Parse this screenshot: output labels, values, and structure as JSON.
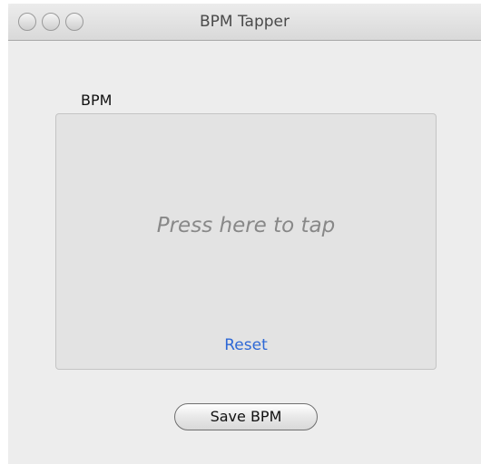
{
  "window": {
    "title": "BPM Tapper"
  },
  "bpm": {
    "label": "BPM"
  },
  "tap_area": {
    "hint": "Press here to tap",
    "reset_label": "Reset"
  },
  "footer": {
    "save_label": "Save BPM"
  },
  "colors": {
    "link": "#2e68d6",
    "window_bg": "#ededed",
    "tap_area_bg": "#e3e3e3"
  }
}
